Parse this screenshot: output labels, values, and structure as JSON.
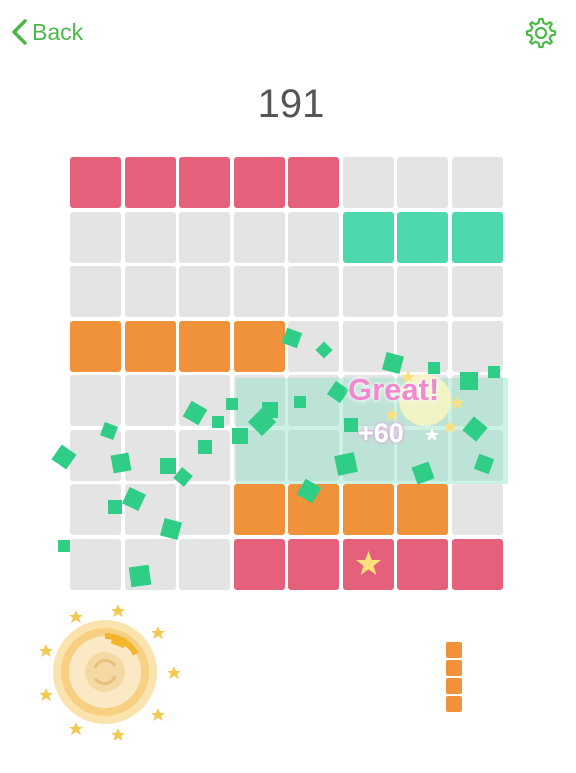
{
  "nav": {
    "back_label": "Back",
    "back_icon": "chevron-left-icon",
    "settings_icon": "gear-icon"
  },
  "score": "191",
  "colors": {
    "accent": "#4cb848",
    "empty": "#e4e4e4",
    "red": "#e5607a",
    "green": "#4ed8ae",
    "orange": "#f0923a",
    "fragment": "#2fcd86",
    "star": "#ffe07a"
  },
  "board": {
    "rows": [
      [
        "red",
        "red",
        "red",
        "red",
        "red",
        "empty",
        "empty",
        "empty"
      ],
      [
        "empty",
        "empty",
        "empty",
        "empty",
        "empty",
        "green",
        "green",
        "green"
      ],
      [
        "empty",
        "empty",
        "empty",
        "empty",
        "empty",
        "empty",
        "empty",
        "empty"
      ],
      [
        "orange",
        "orange",
        "orange",
        "orange",
        "empty",
        "empty",
        "empty",
        "empty"
      ],
      [
        "empty",
        "empty",
        "empty",
        "empty",
        "empty",
        "empty",
        "empty",
        "empty"
      ],
      [
        "empty",
        "empty",
        "empty",
        "empty",
        "empty",
        "empty",
        "empty",
        "empty"
      ],
      [
        "empty",
        "empty",
        "empty",
        "orange",
        "orange",
        "orange",
        "orange",
        "empty"
      ],
      [
        "empty",
        "empty",
        "empty",
        "red",
        "red",
        "star",
        "red",
        "red"
      ]
    ]
  },
  "effects": {
    "praise": "Great!",
    "bonus": "+60"
  },
  "powerup": {
    "icon": "bomb-icon"
  },
  "next_piece": {
    "color": "orange",
    "blocks": 4
  }
}
